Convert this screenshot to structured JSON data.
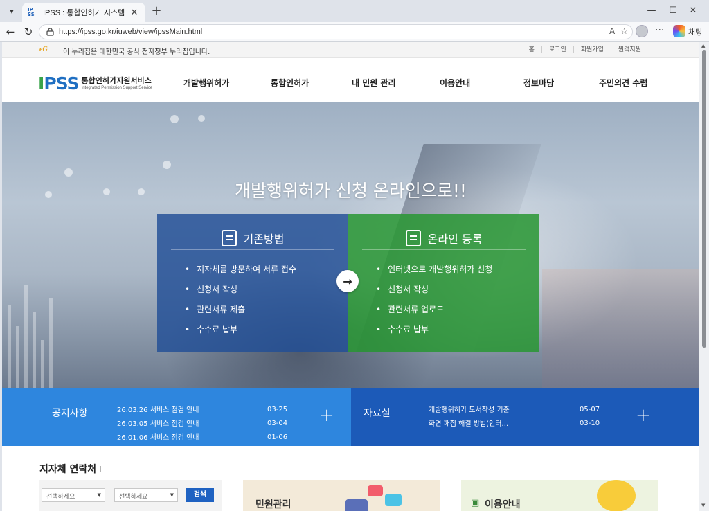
{
  "browser": {
    "tab_title": "IPSS : 통합인허가 시스템",
    "url": "https://ipss.go.kr/iuweb/view/ipssMain.html",
    "chat_label": "채팅"
  },
  "gov_strip": {
    "logo": "eG",
    "text": "이 누리집은 대한민국 공식 전자정부 누리집입니다.",
    "links": [
      "홈",
      "로그인",
      "회원가입",
      "원격지원"
    ]
  },
  "site": {
    "logo_ko": "통합인허가지원서비스",
    "logo_en": "Integrated Permission Support Service",
    "nav": [
      "개발행위허가",
      "통합인허가",
      "내 민원 관리",
      "이용안내",
      "정보마당",
      "주민의견 수렴"
    ]
  },
  "hero": {
    "title": "개발행위허가 신청 온라인으로!!",
    "left_panel": {
      "title": "기존방법",
      "items": [
        "지자체를 방문하여 서류 접수",
        "신청서 작성",
        "관련서류 제출",
        "수수료 납부"
      ]
    },
    "right_panel": {
      "title": "온라인 등록",
      "items": [
        "인터넷으로 개발행위허가 신청",
        "신청서 작성",
        "관련서류 업로드",
        "수수료 납부"
      ]
    }
  },
  "notice": {
    "title": "공지사항",
    "items": [
      {
        "title": "26.03.26 서비스 점검 안내",
        "date": "03-25"
      },
      {
        "title": "26.03.05 서비스 점검 안내",
        "date": "03-04"
      },
      {
        "title": "26.01.06 서비스 점검 안내",
        "date": "01-06"
      }
    ]
  },
  "archive": {
    "title": "자료실",
    "items": [
      {
        "title": "개발행위허가 도서작성 기준",
        "date": "05-07"
      },
      {
        "title": "화면 깨짐 해결 방법(인터…",
        "date": "03-10"
      }
    ]
  },
  "contacts": {
    "title": "지자체 연락처",
    "select1": "선택하세요",
    "select2": "선택하세요",
    "search": "검색"
  },
  "cards": {
    "civil": "민원관리",
    "guide": "이용안내"
  },
  "colors": {
    "notice_bg": "#2e86de",
    "archive_bg": "#1c5ab8",
    "left_panel": "#214e96",
    "right_panel": "#28963 2"
  }
}
